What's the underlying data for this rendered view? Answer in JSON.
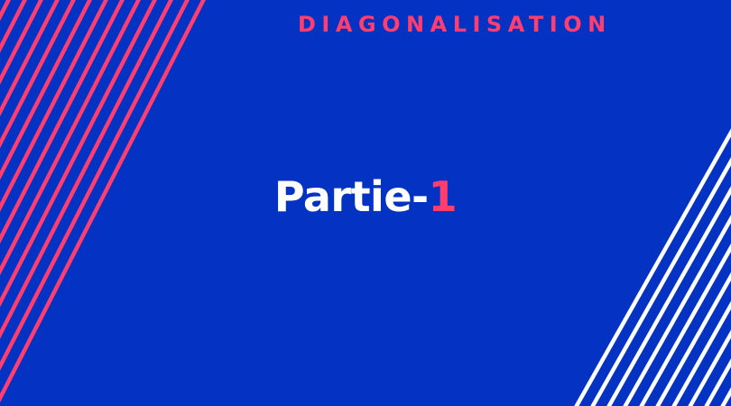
{
  "slide": {
    "heading": "DIAGONALISATION",
    "title_text": "Partie-",
    "title_number": "1"
  },
  "colors": {
    "background": "#0433c4",
    "accent": "#ff3d6e",
    "light": "#ffffff"
  }
}
